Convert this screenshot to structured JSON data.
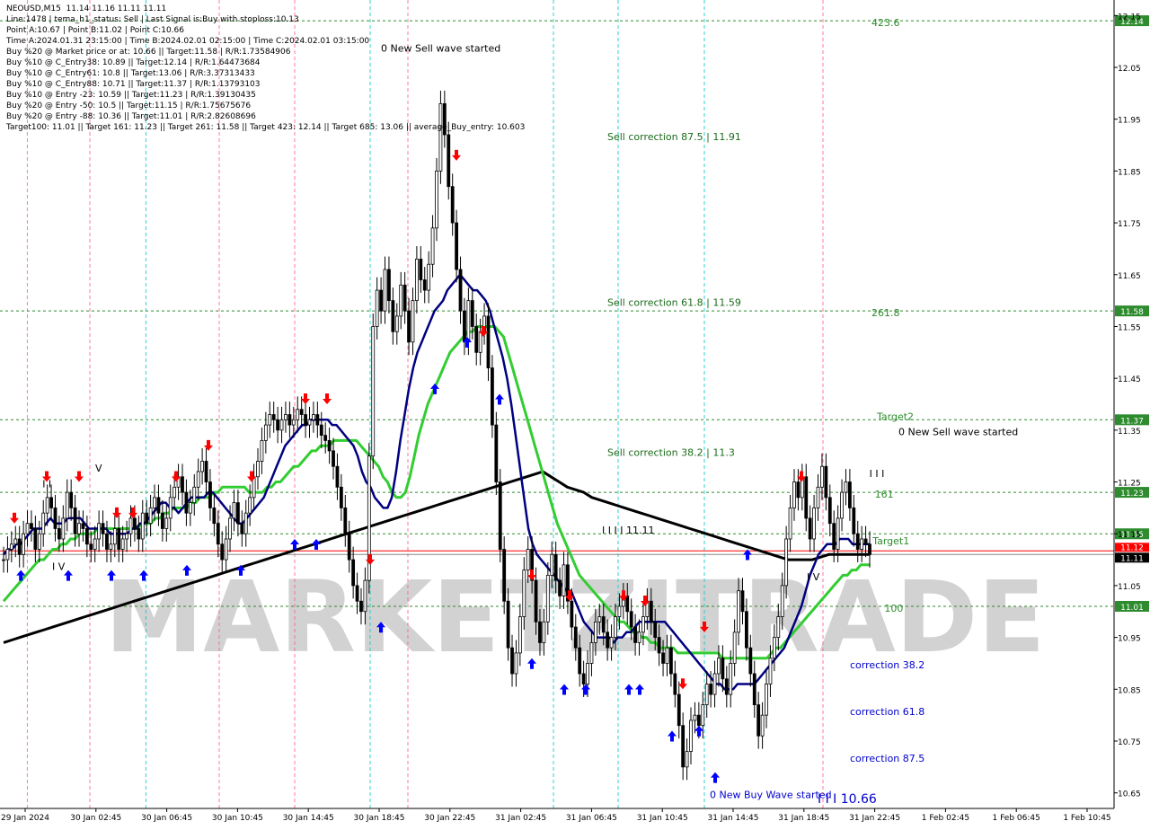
{
  "info_lines": [
    "NEOUSD,M15  11.14 11.16 11.11 11.11",
    "Line:1478 | tema_h1_status: Sell | Last Signal is:Buy with stoploss:10.13",
    "Point A:10.67 | Point B:11.02 | Point C:10.66",
    "Time A:2024.01.31 23:15:00 | Time B:2024.02.01 02:15:00 | Time C:2024.02.01 03:15:00",
    "Buy %20 @ Market price or at: 10.66 || Target:11.58 | R/R:1.73584906",
    "Buy %10 @ C_Entry38: 10.89 || Target:12.14 | R/R:1.64473684",
    "Buy %10 @ C_Entry61: 10.8 || Target:13.06 | R/R:3.37313433",
    "Buy %10 @ C_Entry88: 10.71 || Target:11.37 | R/R:1.13793103",
    "Buy %10 @ Entry -23: 10.59 || Target:11.23 | R/R:1.39130435",
    "Buy %20 @ Entry -50: 10.5 || Target:11.15 | R/R:1.75675676",
    "Buy %20 @ Entry -88: 10.36 || Target:11.01 | R/R:2.82608696",
    "Target100: 11.01 || Target 161: 11.23 || Target 261: 11.58 || Target 423: 12.14 || Target 685: 13.06 || average_Buy_entry: 10.603"
  ],
  "colors": {
    "background": "#ffffff",
    "grid_vertical_blue": "#00c8c8",
    "grid_vertical_red": "#ff5a8c",
    "level_green": "#2e8b2e",
    "price_red": "#ff0000",
    "fast_ma": "#000080",
    "mid_ma": "#32cd32",
    "slow_ma": "#000000",
    "candle": "#000000",
    "arrow_up": "#0000ff",
    "arrow_down": "#ff0000",
    "label_blue": "#0000cd",
    "watermark": "#d2d2d2"
  },
  "watermark_text": "MARKETZITRADE",
  "chart_data": {
    "type": "candlestick",
    "title": "NEOUSD,M15",
    "ylim": [
      10.62,
      12.18
    ],
    "y_ticks": [
      "12.15",
      "12.05",
      "11.95",
      "11.85",
      "11.75",
      "11.65",
      "11.55",
      "11.45",
      "11.35",
      "11.25",
      "11.15",
      "11.05",
      "10.95",
      "10.85",
      "10.75",
      "10.65"
    ],
    "x_ticks": [
      "29 Jan 2024",
      "30 Jan 02:45",
      "30 Jan 06:45",
      "30 Jan 10:45",
      "30 Jan 14:45",
      "30 Jan 18:45",
      "30 Jan 22:45",
      "31 Jan 02:45",
      "31 Jan 06:45",
      "31 Jan 10:45",
      "31 Jan 14:45",
      "31 Jan 18:45",
      "31 Jan 22:45",
      "1 Feb 02:45",
      "1 Feb 06:45",
      "1 Feb 10:45"
    ],
    "levels": [
      {
        "value": 12.14,
        "label": "12.14"
      },
      {
        "value": 11.58,
        "label": "11.58"
      },
      {
        "value": 11.37,
        "label": "11.37"
      },
      {
        "value": 11.23,
        "label": "11.23"
      },
      {
        "value": 11.15,
        "label": "11.15"
      },
      {
        "value": 11.01,
        "label": "11.01"
      }
    ],
    "current_price": {
      "value": 11.11,
      "label": "11.11",
      "other_label": "11.12"
    },
    "annotations": [
      {
        "text": "0 New Sell wave started",
        "x": 0.35,
        "y": 12.08
      },
      {
        "text": "Sell correction 87.5 | 11.91",
        "x": 0.56,
        "y": 11.91
      },
      {
        "text": "Sell correction 61.8 | 11.59",
        "x": 0.56,
        "y": 11.59
      },
      {
        "text": "Sell correction 38.2 | 11.3",
        "x": 0.56,
        "y": 11.3
      },
      {
        "text": "423.6",
        "x": 0.805,
        "y": 12.13
      },
      {
        "text": "261.8",
        "x": 0.805,
        "y": 11.57
      },
      {
        "text": "Target2",
        "x": 0.81,
        "y": 11.37
      },
      {
        "text": "0 New Sell wave started",
        "x": 0.83,
        "y": 11.34
      },
      {
        "text": "I I I",
        "x": 0.803,
        "y": 11.26
      },
      {
        "text": "161",
        "x": 0.808,
        "y": 11.22
      },
      {
        "text": "Target1",
        "x": 0.806,
        "y": 11.13
      },
      {
        "text": "100",
        "x": 0.817,
        "y": 11.0
      },
      {
        "text": "I I I I 11.11",
        "x": 0.555,
        "y": 11.15
      },
      {
        "text": "correction 38.2",
        "x": 0.785,
        "y": 10.89
      },
      {
        "text": "correction 61.8",
        "x": 0.785,
        "y": 10.8
      },
      {
        "text": "correction 87.5",
        "x": 0.785,
        "y": 10.71
      },
      {
        "text": "0 New Buy Wave started",
        "x": 0.655,
        "y": 10.64
      },
      {
        "text": "I I I 10.66",
        "x": 0.755,
        "y": 10.63
      },
      {
        "text": "I V",
        "x": 0.045,
        "y": 11.08
      },
      {
        "text": "V",
        "x": 0.085,
        "y": 11.27
      },
      {
        "text": "I I",
        "x": 0.036,
        "y": 11.24
      },
      {
        "text": "I V",
        "x": 0.745,
        "y": 11.06
      }
    ],
    "close": [
      11.1,
      11.12,
      11.13,
      11.14,
      11.11,
      11.15,
      11.17,
      11.16,
      11.12,
      11.15,
      11.19,
      11.22,
      11.2,
      11.16,
      11.14,
      11.18,
      11.23,
      11.2,
      11.15,
      11.17,
      11.16,
      11.13,
      11.12,
      11.14,
      11.17,
      11.15,
      11.12,
      11.13,
      11.16,
      11.12,
      11.14,
      11.15,
      11.18,
      11.16,
      11.14,
      11.19,
      11.17,
      11.2,
      11.22,
      11.19,
      11.16,
      11.18,
      11.22,
      11.24,
      11.26,
      11.23,
      11.19,
      11.21,
      11.24,
      11.27,
      11.29,
      11.25,
      11.2,
      11.17,
      11.13,
      11.1,
      11.14,
      11.18,
      11.21,
      11.17,
      11.15,
      11.19,
      11.22,
      11.26,
      11.29,
      11.33,
      11.36,
      11.38,
      11.37,
      11.35,
      11.37,
      11.38,
      11.36,
      11.37,
      11.39,
      11.38,
      11.36,
      11.37,
      11.38,
      11.36,
      11.34,
      11.33,
      11.31,
      11.28,
      11.24,
      11.2,
      11.15,
      11.1,
      11.05,
      11.02,
      11.0,
      11.06,
      11.3,
      11.55,
      11.62,
      11.58,
      11.66,
      11.6,
      11.54,
      11.57,
      11.63,
      11.58,
      11.52,
      11.6,
      11.68,
      11.64,
      11.62,
      11.67,
      11.74,
      11.85,
      11.98,
      11.92,
      11.82,
      11.75,
      11.66,
      11.58,
      11.52,
      11.6,
      11.55,
      11.5,
      11.54,
      11.57,
      11.47,
      11.36,
      11.25,
      11.12,
      11.02,
      10.93,
      10.88,
      10.92,
      10.99,
      11.08,
      11.12,
      11.06,
      10.98,
      10.94,
      10.98,
      11.07,
      11.11,
      11.06,
      11.03,
      11.09,
      11.02,
      10.97,
      10.93,
      10.88,
      10.86,
      10.9,
      10.94,
      10.98,
      10.99,
      10.96,
      10.93,
      10.95,
      10.99,
      11.01,
      11.03,
      11.0,
      10.97,
      10.94,
      10.96,
      10.99,
      11.02,
      10.98,
      10.95,
      10.92,
      10.9,
      10.93,
      10.88,
      10.84,
      10.78,
      10.7,
      10.73,
      10.79,
      10.8,
      10.78,
      10.82,
      10.86,
      10.84,
      10.88,
      10.91,
      10.87,
      10.84,
      10.9,
      10.96,
      11.04,
      11.0,
      10.93,
      10.88,
      10.82,
      10.76,
      10.8,
      10.86,
      10.91,
      10.95,
      10.99,
      11.05,
      11.14,
      11.2,
      11.25,
      11.22,
      11.26,
      11.18,
      11.14,
      11.2,
      11.24,
      11.28,
      11.22,
      11.17,
      11.12,
      11.18,
      11.23,
      11.25,
      11.2,
      11.15,
      11.12,
      11.14,
      11.13,
      11.11
    ],
    "fast_ma": [
      11.11,
      11.12,
      11.12,
      11.13,
      11.13,
      11.14,
      11.15,
      11.16,
      11.16,
      11.16,
      11.17,
      11.18,
      11.17,
      11.17,
      11.17,
      11.18,
      11.18,
      11.18,
      11.18,
      11.17,
      11.16,
      11.16,
      11.16,
      11.16,
      11.16,
      11.15,
      11.15,
      11.15,
      11.15,
      11.15,
      11.16,
      11.16,
      11.17,
      11.17,
      11.18,
      11.19,
      11.2,
      11.21,
      11.21,
      11.2,
      11.2,
      11.19,
      11.2,
      11.21,
      11.22,
      11.22,
      11.22,
      11.22,
      11.23,
      11.23,
      11.22,
      11.21,
      11.2,
      11.19,
      11.18,
      11.17,
      11.17,
      11.18,
      11.19,
      11.2,
      11.21,
      11.22,
      11.24,
      11.26,
      11.28,
      11.3,
      11.32,
      11.33,
      11.34,
      11.35,
      11.36,
      11.36,
      11.37,
      11.37,
      11.37,
      11.37,
      11.37,
      11.36,
      11.36,
      11.35,
      11.34,
      11.33,
      11.32,
      11.3,
      11.27,
      11.25,
      11.24,
      11.22,
      11.21,
      11.2,
      11.2,
      11.22,
      11.27,
      11.33,
      11.38,
      11.43,
      11.47,
      11.5,
      11.52,
      11.54,
      11.56,
      11.58,
      11.59,
      11.6,
      11.62,
      11.63,
      11.64,
      11.65,
      11.64,
      11.63,
      11.62,
      11.62,
      11.61,
      11.6,
      11.58,
      11.55,
      11.52,
      11.49,
      11.45,
      11.4,
      11.34,
      11.28,
      11.22,
      11.16,
      11.13,
      11.11,
      11.1,
      11.09,
      11.08,
      11.07,
      11.06,
      11.05,
      11.04,
      11.04,
      11.02,
      11.0,
      10.98,
      10.97,
      10.96,
      10.95,
      10.95,
      10.95,
      10.95,
      10.94,
      10.95,
      10.95,
      10.96,
      10.96,
      10.97,
      10.98,
      10.98,
      10.98,
      10.98,
      10.98,
      10.98,
      10.98,
      10.97,
      10.96,
      10.95,
      10.94,
      10.93,
      10.92,
      10.91,
      10.9,
      10.89,
      10.88,
      10.87,
      10.86,
      10.86,
      10.85,
      10.85,
      10.85,
      10.86,
      10.86,
      10.86,
      10.86,
      10.86,
      10.87,
      10.88,
      10.89,
      10.9,
      10.91,
      10.92,
      10.93,
      10.95,
      10.97,
      10.99,
      11.01,
      11.04,
      11.07,
      11.09,
      11.11,
      11.12,
      11.13,
      11.13,
      11.13,
      11.14,
      11.14,
      11.14,
      11.13,
      11.13,
      11.13,
      11.13,
      11.13
    ],
    "mid_ma": [
      11.02,
      11.03,
      11.04,
      11.05,
      11.06,
      11.07,
      11.08,
      11.09,
      11.1,
      11.1,
      11.11,
      11.12,
      11.12,
      11.13,
      11.13,
      11.14,
      11.14,
      11.15,
      11.15,
      11.15,
      11.15,
      11.16,
      11.16,
      11.16,
      11.16,
      11.16,
      11.16,
      11.16,
      11.16,
      11.16,
      11.16,
      11.17,
      11.17,
      11.17,
      11.18,
      11.18,
      11.19,
      11.19,
      11.2,
      11.2,
      11.2,
      11.2,
      11.21,
      11.21,
      11.22,
      11.22,
      11.22,
      11.23,
      11.23,
      11.24,
      11.24,
      11.24,
      11.24,
      11.24,
      11.24,
      11.23,
      11.23,
      11.23,
      11.23,
      11.24,
      11.24,
      11.25,
      11.25,
      11.26,
      11.27,
      11.28,
      11.28,
      11.29,
      11.3,
      11.31,
      11.31,
      11.32,
      11.32,
      11.32,
      11.33,
      11.33,
      11.33,
      11.33,
      11.33,
      11.33,
      11.32,
      11.31,
      11.3,
      11.29,
      11.28,
      11.26,
      11.25,
      11.23,
      11.22,
      11.22,
      11.23,
      11.26,
      11.3,
      11.34,
      11.37,
      11.4,
      11.42,
      11.44,
      11.46,
      11.48,
      11.5,
      11.51,
      11.52,
      11.53,
      11.54,
      11.54,
      11.55,
      11.55,
      11.55,
      11.55,
      11.55,
      11.54,
      11.53,
      11.5,
      11.47,
      11.44,
      11.41,
      11.38,
      11.35,
      11.32,
      11.29,
      11.26,
      11.23,
      11.2,
      11.17,
      11.15,
      11.13,
      11.11,
      11.09,
      11.07,
      11.06,
      11.05,
      11.04,
      11.03,
      11.02,
      11.01,
      11.0,
      10.99,
      10.98,
      10.98,
      10.97,
      10.96,
      10.96,
      10.95,
      10.95,
      10.94,
      10.94,
      10.93,
      10.93,
      10.93,
      10.93,
      10.92,
      10.92,
      10.92,
      10.92,
      10.92,
      10.92,
      10.92,
      10.92,
      10.92,
      10.92,
      10.91,
      10.91,
      10.91,
      10.91,
      10.91,
      10.91,
      10.91,
      10.91,
      10.91,
      10.91,
      10.91,
      10.92,
      10.93,
      10.93,
      10.94,
      10.95,
      10.96,
      10.97,
      10.98,
      10.99,
      11.0,
      11.01,
      11.02,
      11.03,
      11.04,
      11.05,
      11.06,
      11.07,
      11.07,
      11.08,
      11.08,
      11.09,
      11.09,
      11.09
    ],
    "slow_ma": [
      10.94,
      10.945,
      10.95,
      10.955,
      10.96,
      10.965,
      10.97,
      10.975,
      10.98,
      10.985,
      10.99,
      10.995,
      11.0,
      11.005,
      11.01,
      11.015,
      11.02,
      11.025,
      11.03,
      11.035,
      11.04,
      11.045,
      11.05,
      11.055,
      11.06,
      11.065,
      11.07,
      11.075,
      11.08,
      11.085,
      11.09,
      11.095,
      11.1,
      11.105,
      11.11,
      11.115,
      11.12,
      11.125,
      11.13,
      11.135,
      11.14,
      11.145,
      11.15,
      11.155,
      11.16,
      11.165,
      11.17,
      11.175,
      11.18,
      11.185,
      11.19,
      11.195,
      11.2,
      11.205,
      11.21,
      11.215,
      11.22,
      11.225,
      11.23,
      11.235,
      11.24,
      11.245,
      11.25,
      11.255,
      11.26,
      11.265,
      11.27,
      11.26,
      11.25,
      11.24,
      11.235,
      11.23,
      11.22,
      11.215,
      11.21,
      11.205,
      11.2,
      11.195,
      11.19,
      11.185,
      11.18,
      11.175,
      11.17,
      11.165,
      11.16,
      11.155,
      11.15,
      11.145,
      11.14,
      11.135,
      11.13,
      11.125,
      11.12,
      11.115,
      11.11,
      11.105,
      11.1,
      11.1,
      11.1,
      11.1,
      11.105,
      11.11,
      11.11,
      11.11,
      11.11,
      11.11,
      11.11
    ],
    "up_arrows": [
      [
        0.016,
        11.08
      ],
      [
        0.06,
        11.08
      ],
      [
        0.1,
        11.08
      ],
      [
        0.13,
        11.08
      ],
      [
        0.17,
        11.09
      ],
      [
        0.22,
        11.09
      ],
      [
        0.27,
        11.14
      ],
      [
        0.29,
        11.14
      ],
      [
        0.35,
        10.98
      ],
      [
        0.4,
        11.44
      ],
      [
        0.43,
        11.53
      ],
      [
        0.46,
        11.42
      ],
      [
        0.49,
        10.91
      ],
      [
        0.52,
        10.86
      ],
      [
        0.54,
        10.86
      ],
      [
        0.58,
        10.86
      ],
      [
        0.59,
        10.86
      ],
      [
        0.62,
        10.77
      ],
      [
        0.645,
        10.78
      ],
      [
        0.66,
        10.69
      ],
      [
        0.69,
        11.12
      ]
    ],
    "down_arrows": [
      [
        0.01,
        11.17
      ],
      [
        0.04,
        11.25
      ],
      [
        0.07,
        11.25
      ],
      [
        0.105,
        11.18
      ],
      [
        0.12,
        11.18
      ],
      [
        0.16,
        11.25
      ],
      [
        0.19,
        11.31
      ],
      [
        0.23,
        11.25
      ],
      [
        0.28,
        11.4
      ],
      [
        0.3,
        11.4
      ],
      [
        0.34,
        11.09
      ],
      [
        0.42,
        11.87
      ],
      [
        0.445,
        11.53
      ],
      [
        0.49,
        11.06
      ],
      [
        0.525,
        11.02
      ],
      [
        0.575,
        11.02
      ],
      [
        0.595,
        11.01
      ],
      [
        0.63,
        10.85
      ],
      [
        0.65,
        10.96
      ],
      [
        0.74,
        11.25
      ]
    ]
  }
}
